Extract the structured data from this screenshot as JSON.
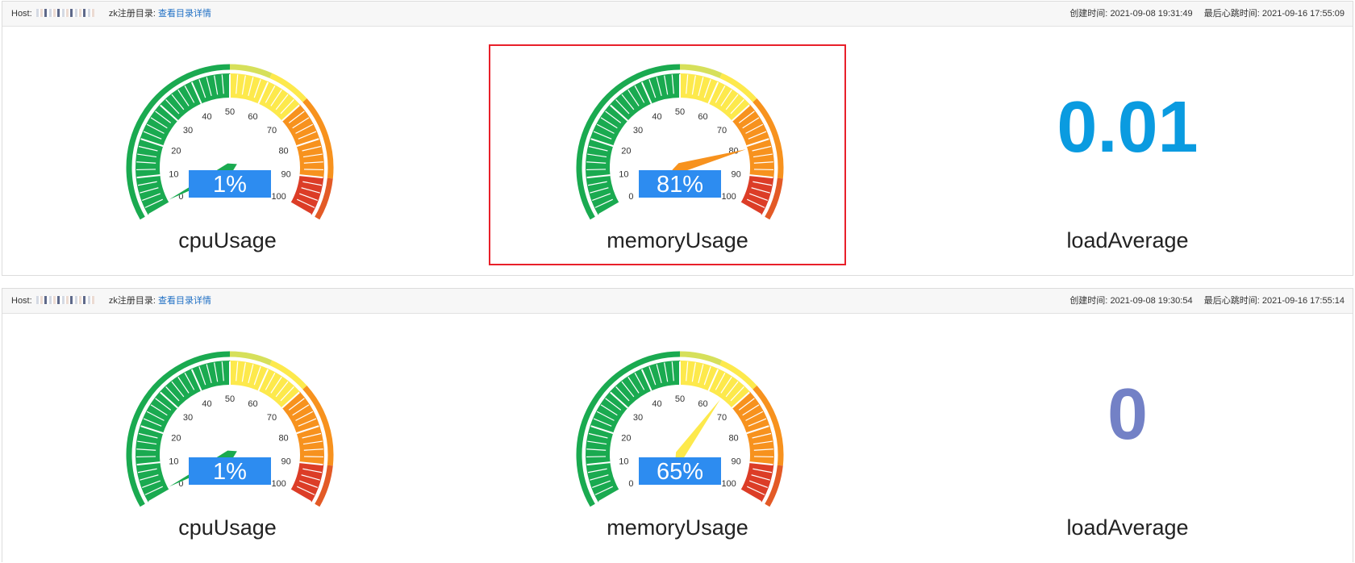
{
  "colors": {
    "green": "#1aaa50",
    "yellow": "#fde94c",
    "orange": "#f7921e",
    "red": "#dc3d27",
    "badge": "#2d8cf0",
    "link": "#1f6fc4",
    "highlight": "#e8202a",
    "load1": "#0a9be0",
    "load2": "#7381c6"
  },
  "gauge_ticks": [
    "0",
    "10",
    "20",
    "30",
    "40",
    "50",
    "60",
    "70",
    "80",
    "90",
    "100"
  ],
  "hosts": [
    {
      "host_label": "Host:",
      "host_value": "17? ?? ??.??",
      "zk_label": "zk注册目录:",
      "zk_link": "查看目录详情",
      "created_label": "创建时间:",
      "created_value": "2021-09-08 19:31:49",
      "heartbeat_label": "最后心跳时间:",
      "heartbeat_value": "2021-09-16 17:55:09",
      "cpu": {
        "name": "cpuUsage",
        "value": 1,
        "display": "1%"
      },
      "memory": {
        "name": "memoryUsage",
        "value": 81,
        "display": "81%"
      },
      "load": {
        "name": "loadAverage",
        "display": "0.01"
      }
    },
    {
      "host_label": "Host:",
      "host_value": "??.??.??",
      "zk_label": "zk注册目录:",
      "zk_link": "查看目录详情",
      "created_label": "创建时间:",
      "created_value": "2021-09-08 19:30:54",
      "heartbeat_label": "最后心跳时间:",
      "heartbeat_value": "2021-09-16 17:55:14",
      "cpu": {
        "name": "cpuUsage",
        "value": 1,
        "display": "1%"
      },
      "memory": {
        "name": "memoryUsage",
        "value": 65,
        "display": "65%"
      },
      "load": {
        "name": "loadAverage",
        "display": "0"
      }
    }
  ]
}
